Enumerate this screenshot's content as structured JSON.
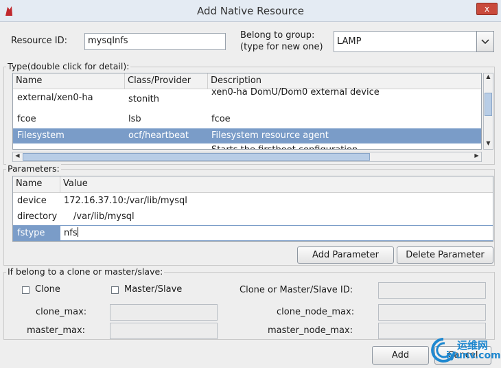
{
  "window": {
    "title": "Add Native Resource",
    "close_label": "x"
  },
  "resource": {
    "id_label": "Resource ID:",
    "id_value": "mysqlnfs",
    "group_label_line1": "Belong to group:",
    "group_label_line2": "(type for new one)",
    "group_value": "LAMP"
  },
  "type_section": {
    "legend": "Type(double click for detail):",
    "headers": [
      "Name",
      "Class/Provider",
      "Description"
    ],
    "rows": [
      [
        "external/xen0-ha",
        "stonith",
        "xen0-ha DomU/Dom0 external device"
      ],
      [
        "fcoe",
        "lsb",
        "fcoe"
      ],
      [
        "Filesystem",
        "ocf/heartbeat",
        "Filesystem resource agent"
      ],
      [
        "",
        "",
        "Starts the firstboot configuration"
      ]
    ]
  },
  "parameters": {
    "legend": "Parameters:",
    "headers": [
      "Name",
      "Value"
    ],
    "rows": [
      [
        "device",
        "172.16.37.10:/var/lib/mysql"
      ],
      [
        "directory",
        "/var/lib/mysql"
      ],
      [
        "fstype",
        "nfs"
      ]
    ],
    "add_label": "Add Parameter",
    "delete_label": "Delete Parameter"
  },
  "clone_section": {
    "legend": "If belong to a clone or master/slave:",
    "clone_label": "Clone",
    "master_slave_label": "Master/Slave",
    "clone_id_label": "Clone or Master/Slave ID:",
    "clone_max_label": "clone_max:",
    "clone_node_max_label": "clone_node_max:",
    "master_max_label": "master_max:",
    "master_node_max_label": "master_node_max:"
  },
  "footer": {
    "add_label": "Add",
    "cancel_label": "Cancel"
  },
  "watermark": {
    "line1": "运维网",
    "line2": "iyunv.com"
  }
}
